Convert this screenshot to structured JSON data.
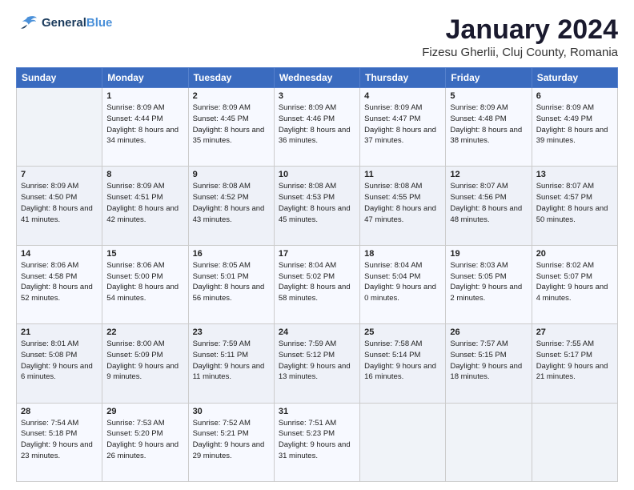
{
  "logo": {
    "line1": "General",
    "line2": "Blue"
  },
  "title": "January 2024",
  "subtitle": "Fizesu Gherlii, Cluj County, Romania",
  "header_days": [
    "Sunday",
    "Monday",
    "Tuesday",
    "Wednesday",
    "Thursday",
    "Friday",
    "Saturday"
  ],
  "weeks": [
    [
      {
        "day": "",
        "sunrise": "",
        "sunset": "",
        "daylight": ""
      },
      {
        "day": "1",
        "sunrise": "Sunrise: 8:09 AM",
        "sunset": "Sunset: 4:44 PM",
        "daylight": "Daylight: 8 hours and 34 minutes."
      },
      {
        "day": "2",
        "sunrise": "Sunrise: 8:09 AM",
        "sunset": "Sunset: 4:45 PM",
        "daylight": "Daylight: 8 hours and 35 minutes."
      },
      {
        "day": "3",
        "sunrise": "Sunrise: 8:09 AM",
        "sunset": "Sunset: 4:46 PM",
        "daylight": "Daylight: 8 hours and 36 minutes."
      },
      {
        "day": "4",
        "sunrise": "Sunrise: 8:09 AM",
        "sunset": "Sunset: 4:47 PM",
        "daylight": "Daylight: 8 hours and 37 minutes."
      },
      {
        "day": "5",
        "sunrise": "Sunrise: 8:09 AM",
        "sunset": "Sunset: 4:48 PM",
        "daylight": "Daylight: 8 hours and 38 minutes."
      },
      {
        "day": "6",
        "sunrise": "Sunrise: 8:09 AM",
        "sunset": "Sunset: 4:49 PM",
        "daylight": "Daylight: 8 hours and 39 minutes."
      }
    ],
    [
      {
        "day": "7",
        "sunrise": "Sunrise: 8:09 AM",
        "sunset": "Sunset: 4:50 PM",
        "daylight": "Daylight: 8 hours and 41 minutes."
      },
      {
        "day": "8",
        "sunrise": "Sunrise: 8:09 AM",
        "sunset": "Sunset: 4:51 PM",
        "daylight": "Daylight: 8 hours and 42 minutes."
      },
      {
        "day": "9",
        "sunrise": "Sunrise: 8:08 AM",
        "sunset": "Sunset: 4:52 PM",
        "daylight": "Daylight: 8 hours and 43 minutes."
      },
      {
        "day": "10",
        "sunrise": "Sunrise: 8:08 AM",
        "sunset": "Sunset: 4:53 PM",
        "daylight": "Daylight: 8 hours and 45 minutes."
      },
      {
        "day": "11",
        "sunrise": "Sunrise: 8:08 AM",
        "sunset": "Sunset: 4:55 PM",
        "daylight": "Daylight: 8 hours and 47 minutes."
      },
      {
        "day": "12",
        "sunrise": "Sunrise: 8:07 AM",
        "sunset": "Sunset: 4:56 PM",
        "daylight": "Daylight: 8 hours and 48 minutes."
      },
      {
        "day": "13",
        "sunrise": "Sunrise: 8:07 AM",
        "sunset": "Sunset: 4:57 PM",
        "daylight": "Daylight: 8 hours and 50 minutes."
      }
    ],
    [
      {
        "day": "14",
        "sunrise": "Sunrise: 8:06 AM",
        "sunset": "Sunset: 4:58 PM",
        "daylight": "Daylight: 8 hours and 52 minutes."
      },
      {
        "day": "15",
        "sunrise": "Sunrise: 8:06 AM",
        "sunset": "Sunset: 5:00 PM",
        "daylight": "Daylight: 8 hours and 54 minutes."
      },
      {
        "day": "16",
        "sunrise": "Sunrise: 8:05 AM",
        "sunset": "Sunset: 5:01 PM",
        "daylight": "Daylight: 8 hours and 56 minutes."
      },
      {
        "day": "17",
        "sunrise": "Sunrise: 8:04 AM",
        "sunset": "Sunset: 5:02 PM",
        "daylight": "Daylight: 8 hours and 58 minutes."
      },
      {
        "day": "18",
        "sunrise": "Sunrise: 8:04 AM",
        "sunset": "Sunset: 5:04 PM",
        "daylight": "Daylight: 9 hours and 0 minutes."
      },
      {
        "day": "19",
        "sunrise": "Sunrise: 8:03 AM",
        "sunset": "Sunset: 5:05 PM",
        "daylight": "Daylight: 9 hours and 2 minutes."
      },
      {
        "day": "20",
        "sunrise": "Sunrise: 8:02 AM",
        "sunset": "Sunset: 5:07 PM",
        "daylight": "Daylight: 9 hours and 4 minutes."
      }
    ],
    [
      {
        "day": "21",
        "sunrise": "Sunrise: 8:01 AM",
        "sunset": "Sunset: 5:08 PM",
        "daylight": "Daylight: 9 hours and 6 minutes."
      },
      {
        "day": "22",
        "sunrise": "Sunrise: 8:00 AM",
        "sunset": "Sunset: 5:09 PM",
        "daylight": "Daylight: 9 hours and 9 minutes."
      },
      {
        "day": "23",
        "sunrise": "Sunrise: 7:59 AM",
        "sunset": "Sunset: 5:11 PM",
        "daylight": "Daylight: 9 hours and 11 minutes."
      },
      {
        "day": "24",
        "sunrise": "Sunrise: 7:59 AM",
        "sunset": "Sunset: 5:12 PM",
        "daylight": "Daylight: 9 hours and 13 minutes."
      },
      {
        "day": "25",
        "sunrise": "Sunrise: 7:58 AM",
        "sunset": "Sunset: 5:14 PM",
        "daylight": "Daylight: 9 hours and 16 minutes."
      },
      {
        "day": "26",
        "sunrise": "Sunrise: 7:57 AM",
        "sunset": "Sunset: 5:15 PM",
        "daylight": "Daylight: 9 hours and 18 minutes."
      },
      {
        "day": "27",
        "sunrise": "Sunrise: 7:55 AM",
        "sunset": "Sunset: 5:17 PM",
        "daylight": "Daylight: 9 hours and 21 minutes."
      }
    ],
    [
      {
        "day": "28",
        "sunrise": "Sunrise: 7:54 AM",
        "sunset": "Sunset: 5:18 PM",
        "daylight": "Daylight: 9 hours and 23 minutes."
      },
      {
        "day": "29",
        "sunrise": "Sunrise: 7:53 AM",
        "sunset": "Sunset: 5:20 PM",
        "daylight": "Daylight: 9 hours and 26 minutes."
      },
      {
        "day": "30",
        "sunrise": "Sunrise: 7:52 AM",
        "sunset": "Sunset: 5:21 PM",
        "daylight": "Daylight: 9 hours and 29 minutes."
      },
      {
        "day": "31",
        "sunrise": "Sunrise: 7:51 AM",
        "sunset": "Sunset: 5:23 PM",
        "daylight": "Daylight: 9 hours and 31 minutes."
      },
      {
        "day": "",
        "sunrise": "",
        "sunset": "",
        "daylight": ""
      },
      {
        "day": "",
        "sunrise": "",
        "sunset": "",
        "daylight": ""
      },
      {
        "day": "",
        "sunrise": "",
        "sunset": "",
        "daylight": ""
      }
    ]
  ]
}
